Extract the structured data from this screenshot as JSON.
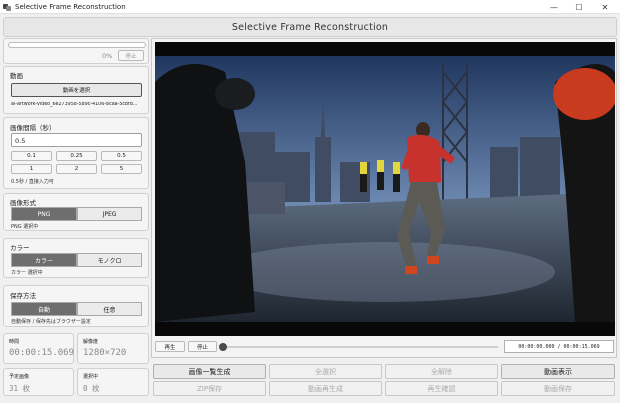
{
  "window": {
    "title": "Selective Frame Reconstruction",
    "minimize": "—",
    "maximize": "☐",
    "close": "✕"
  },
  "header": {
    "title": "Selective Frame Reconstruction"
  },
  "progress": {
    "percent_text": "0%",
    "value": 0,
    "stop_label": "停止"
  },
  "video_panel": {
    "title": "動画",
    "select_label": "動画を選択",
    "filename": "ai-artwork-video_6e273958-589c-4106-8caa-5cbfd..."
  },
  "interval_panel": {
    "title": "画像間隔（秒）",
    "value": "0.5",
    "presets": [
      "0.1",
      "0.25",
      "0.5",
      "1",
      "2",
      "5"
    ],
    "note": "0.5秒 / 直接入力可"
  },
  "format_panel": {
    "title": "画像形式",
    "options": [
      "PNG",
      "JPEG"
    ],
    "selected": "PNG",
    "status": "PNG 選択中"
  },
  "color_panel": {
    "title": "カラー",
    "options": [
      "カラー",
      "モノクロ"
    ],
    "selected": "カラー",
    "status": "カラー 選択中"
  },
  "save_panel": {
    "title": "保存方法",
    "options": [
      "自動",
      "任意"
    ],
    "selected": "自動",
    "status": "自動保存 / 保存先はブラウザー設定"
  },
  "info": {
    "time_label": "時間",
    "time_value": "00:00:15.069",
    "resolution_label": "解像度",
    "resolution_value": "1280×720",
    "planned_label": "予定画像",
    "planned_value": "31 枚",
    "selected_label": "選択中",
    "selected_value": "0 枚"
  },
  "player": {
    "play_label": "再生",
    "stop_label": "停止",
    "time_text": "00:00:00.000 / 00:00:15.069",
    "position": 0
  },
  "actions": [
    {
      "label": "画像一覧生成",
      "enabled": true
    },
    {
      "label": "全選択",
      "enabled": false
    },
    {
      "label": "全解除",
      "enabled": false
    },
    {
      "label": "動画表示",
      "enabled": true
    },
    {
      "label": "ZIP保存",
      "enabled": false
    },
    {
      "label": "動画再生成",
      "enabled": false
    },
    {
      "label": "再生確認",
      "enabled": false
    },
    {
      "label": "動画保存",
      "enabled": false
    }
  ],
  "colors": {
    "accent_selected": "#6e6e6e",
    "video_sky_top": "#2b4a7c",
    "runner_jacket": "#c8322d"
  }
}
